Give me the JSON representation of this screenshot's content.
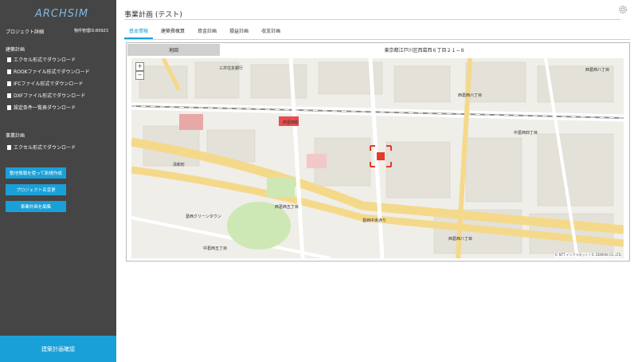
{
  "sidebar": {
    "logo": "ARCHSIM",
    "project_label": "プロジェクト詳細",
    "project_id": "物件管理ID:80923",
    "section_buildings": "建築計画",
    "downloads": [
      "エクセル形式でダウンロード",
      "ROOKファイル形式でダウンロード",
      "IFCファイル形式でダウンロード",
      "DXFファイル形式でダウンロード",
      "設定条件一覧表ダウンロード"
    ],
    "section_business": "事業計画",
    "business_downloads": [
      "エクセル形式でダウンロード"
    ],
    "buttons": [
      "敷地情報を使って新規作成",
      "プロジェクト名変更",
      "事業計画を編集"
    ],
    "confirm": "建築計画確認"
  },
  "header": {
    "title": "事業計画 (テスト)",
    "tabs": [
      "基本情報",
      "建築費概算",
      "資金計画",
      "損益計画",
      "収支計画"
    ],
    "active_tab": 0
  },
  "map": {
    "label": "地図",
    "address": "東京都江戸川区西葛西６丁目２１−８",
    "zoom_in": "+",
    "zoom_out": "−",
    "attribution": "© NTT インフラネット / © ZENRIN CO.,LTD.",
    "place_labels": [
      "西葛西駅",
      "西葛西六丁目",
      "西葛西八丁目",
      "西葛西五丁目",
      "西葛西八丁目",
      "中葛西四丁目",
      "中葛西五丁目",
      "清新町",
      "葛西クリーンタウン",
      "三井住友銀行",
      "葛西中央通り"
    ],
    "colors": {
      "road": "#f5d98a",
      "block": "#efeee8",
      "green": "#cde8b5",
      "rail": "#8a8a8a",
      "selection": "#e23b2a"
    }
  }
}
